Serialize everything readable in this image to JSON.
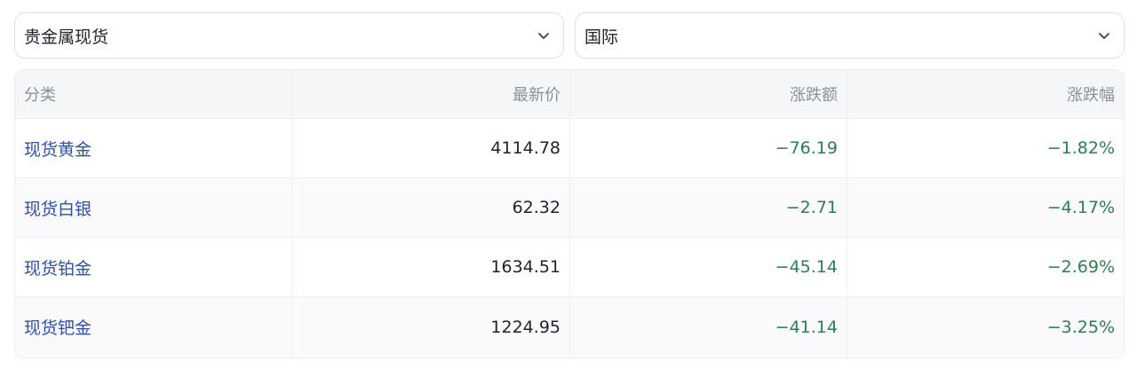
{
  "filters": {
    "category": {
      "value": "贵金属现货"
    },
    "region": {
      "value": "国际"
    }
  },
  "table": {
    "headers": [
      "分类",
      "最新价",
      "涨跌额",
      "涨跌幅"
    ],
    "rows": [
      {
        "name": "现货黄金",
        "price": "4114.78",
        "change": "−76.19",
        "change_pct": "−1.82%"
      },
      {
        "name": "现货白银",
        "price": "62.32",
        "change": "−2.71",
        "change_pct": "−4.17%"
      },
      {
        "name": "现货铂金",
        "price": "1634.51",
        "change": "−45.14",
        "change_pct": "−2.69%"
      },
      {
        "name": "现货钯金",
        "price": "1224.95",
        "change": "−41.14",
        "change_pct": "−3.25%"
      }
    ]
  },
  "colors": {
    "link": "#2f4fa8",
    "down": "#2f7d55",
    "header_bg": "#f5f6f8"
  },
  "icons": {
    "dropdown": "chevron-down-icon"
  }
}
